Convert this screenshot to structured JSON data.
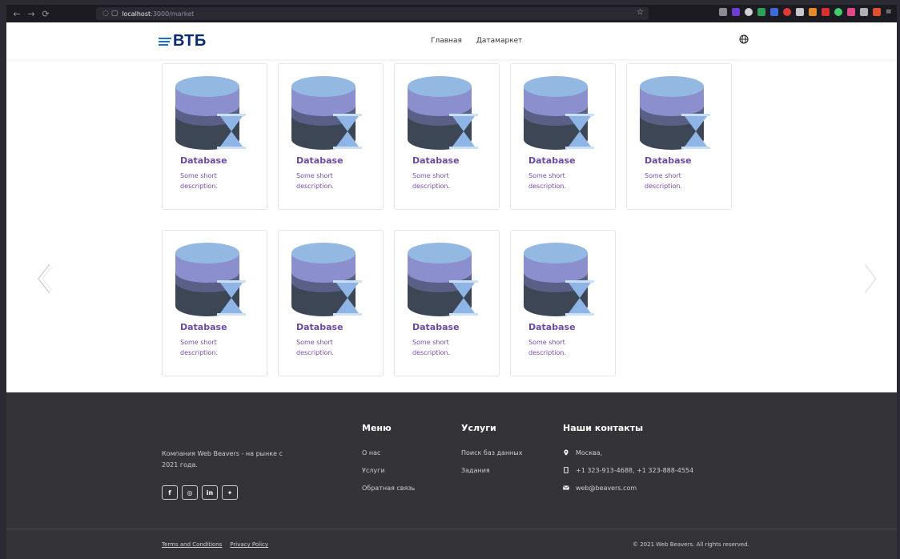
{
  "browser": {
    "url_host": "localhost",
    "url_path": ":3000/market",
    "nav": [
      "←",
      "→",
      "⟳"
    ]
  },
  "header": {
    "logo_text": "ВТБ",
    "nav": [
      {
        "label": "Главная"
      },
      {
        "label": "Датамаркет"
      }
    ],
    "language_icon": "globe-icon"
  },
  "cards": [
    {
      "title": "Database",
      "description": "Some short description."
    },
    {
      "title": "Database",
      "description": "Some short description."
    },
    {
      "title": "Database",
      "description": "Some short description."
    },
    {
      "title": "Database",
      "description": "Some short description."
    },
    {
      "title": "Database",
      "description": "Some short description."
    },
    {
      "title": "Database",
      "description": "Some short description."
    },
    {
      "title": "Database",
      "description": "Some short description."
    },
    {
      "title": "Database",
      "description": "Some short description."
    },
    {
      "title": "Database",
      "description": "Some short description."
    }
  ],
  "carousel": {
    "prev_icon": "chevron-left-icon",
    "next_icon": "chevron-right-icon"
  },
  "footer": {
    "about": "Компания Web Beavers - на рынке с 2021 года.",
    "socials": [
      "f",
      "◎",
      "in",
      "✦"
    ],
    "menu": {
      "title": "Меню",
      "items": [
        "О нас",
        "Услуги",
        "Обратная связь"
      ]
    },
    "services": {
      "title": "Услуги",
      "items": [
        "Поиск баз данных",
        "Задания"
      ]
    },
    "contacts": {
      "title": "Наши контакты",
      "city": "Москва,",
      "phone": "+1 323-913-4688, +1 323-888-4554",
      "email": "web@beavers.com"
    },
    "terms": "Terms and Conditions",
    "privacy": "Privacy Policy",
    "copyright": "© 2021 Web Beavers. All rights reserved."
  },
  "colors": {
    "accent": "#6b4aa3",
    "brand": "#0a2973",
    "footer_bg": "#333338"
  }
}
